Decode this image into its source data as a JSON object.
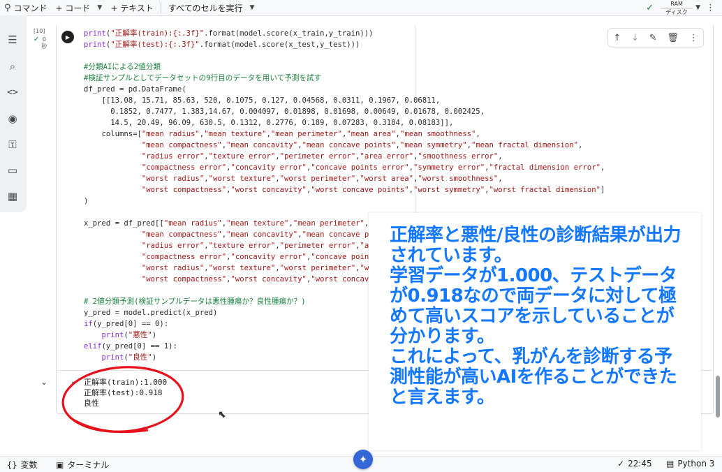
{
  "toolbar": {
    "command_label": "コマンド",
    "code_label": "+ コード",
    "text_label": "+ テキスト",
    "run_all_label": "すべてのセルを実行",
    "ram_label": "RAM",
    "disk_label": "ディスク"
  },
  "cell": {
    "exec_count": "[10]",
    "exec_time": "0\n秒",
    "code_lines": [
      "print(\"正解率(train):{:.3f}\".format(model.score(x_train,y_train)))",
      "print(\"正解率(test):{:.3f}\".format(model.score(x_test,y_test)))",
      "",
      "#分類AIによる2値分類",
      "#検証サンプルとしてデータセットの9行目のデータを用いて予測を試す",
      "df_pred = pd.DataFrame(",
      "    [[13.08, 15.71, 85.63, 520, 0.1075, 0.127, 0.04568, 0.0311, 0.1967, 0.06811,",
      "      0.1852, 0.7477, 1.383,14.67, 0.004097, 0.01898, 0.01698, 0.00649, 0.01678, 0.002425,",
      "      14.5, 20.49, 96.09, 630.5, 0.1312, 0.2776, 0.189, 0.07283, 0.3184, 0.08183]],",
      "    columns=[\"mean radius\",\"mean texture\",\"mean perimeter\",\"mean area\",\"mean smoothness\",",
      "             \"mean compactness\",\"mean concavity\",\"mean concave points\",\"mean symmetry\",\"mean fractal dimension\",",
      "             \"radius error\",\"texture error\",\"perimeter error\",\"area error\",\"smoothness error\",",
      "             \"compactness error\",\"concavity error\",\"concave points error\",\"symmetry error\",\"fractal dimension error\",",
      "             \"worst radius\",\"worst texture\",\"worst perimeter\",\"worst area\",\"worst smoothness\",",
      "             \"worst compactness\",\"worst concavity\",\"worst concave points\",\"worst symmetry\",\"worst fractal dimension\"]",
      ")",
      "",
      "x_pred = df_pred[[\"mean radius\",\"mean texture\",\"mean perimeter\",\"mean",
      "             \"mean compactness\",\"mean concavity\",\"mean concave points",
      "             \"radius error\",\"texture error\",\"perimeter error\",\"area e",
      "             \"compactness error\",\"concavity error\",\"concave points er",
      "             \"worst radius\",\"worst texture\",\"worst perimeter\",\"worst",
      "             \"worst compactness\",\"worst concavity\",\"worst concave po",
      "",
      "# 2値分類予測(検証サンプルデータは悪性腫瘍か？良性腫瘍か？)",
      "y_pred = model.predict(x_pred)",
      "if(y_pred[0] == 0):",
      "    print(\"悪性\")",
      "elif(y_pred[0] == 1):",
      "    print(\"良性\")"
    ],
    "output_lines": [
      "正解率(train):1.000",
      "正解率(test):0.918",
      "良性"
    ]
  },
  "annotation": {
    "text": "正解率と悪性/良性の診断結果が出力されています。\n学習データが1.000、テストデータが0.918なので両データに対して極めて高いスコアを示していることが分かります。\nこれによって、乳がんを診断する予測性能が高いAIを作ることができたと言えます。",
    "color": "#1478ff"
  },
  "statusbar": {
    "variables_label": "変数",
    "terminal_label": "ターミナル",
    "time": "22:45",
    "runtime": "Python 3"
  },
  "colors": {
    "highlight_circle": "#e8101a",
    "accent": "#1478ff"
  }
}
